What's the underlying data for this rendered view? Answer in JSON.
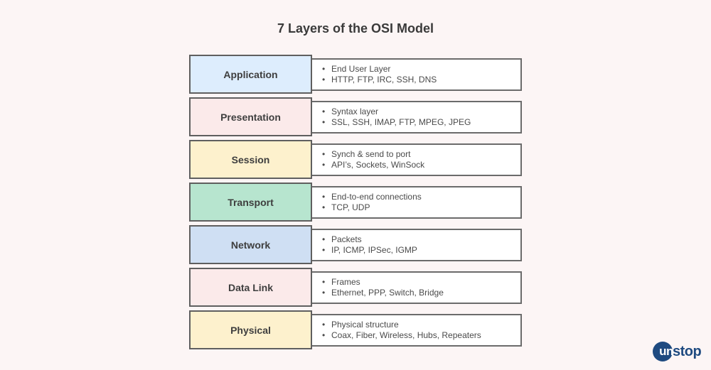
{
  "title": "7 Layers of the OSI Model",
  "layers": [
    {
      "name": "Application",
      "color": "#ddedfd",
      "points": [
        "End User Layer",
        "HTTP, FTP, IRC, SSH, DNS"
      ]
    },
    {
      "name": "Presentation",
      "color": "#fbeaea",
      "points": [
        "Syntax layer",
        "SSL, SSH, IMAP, FTP, MPEG, JPEG"
      ]
    },
    {
      "name": "Session",
      "color": "#fdf1cd",
      "points": [
        "Synch & send to port",
        "API’s, Sockets, WinSock"
      ]
    },
    {
      "name": "Transport",
      "color": "#b7e5cf",
      "points": [
        "End-to-end connections",
        "TCP, UDP"
      ]
    },
    {
      "name": "Network",
      "color": "#cfdff3",
      "points": [
        "Packets",
        "IP, ICMP, IPSec, IGMP"
      ]
    },
    {
      "name": "Data Link",
      "color": "#fbeaea",
      "points": [
        "Frames",
        "Ethernet, PPP, Switch, Bridge"
      ]
    },
    {
      "name": "Physical",
      "color": "#fdf1cd",
      "points": [
        "Physical structure",
        "Coax, Fiber, Wireless, Hubs, Repeaters"
      ]
    }
  ],
  "logo": {
    "prefix": "un",
    "suffix": "stop",
    "color": "#1e4a80"
  }
}
